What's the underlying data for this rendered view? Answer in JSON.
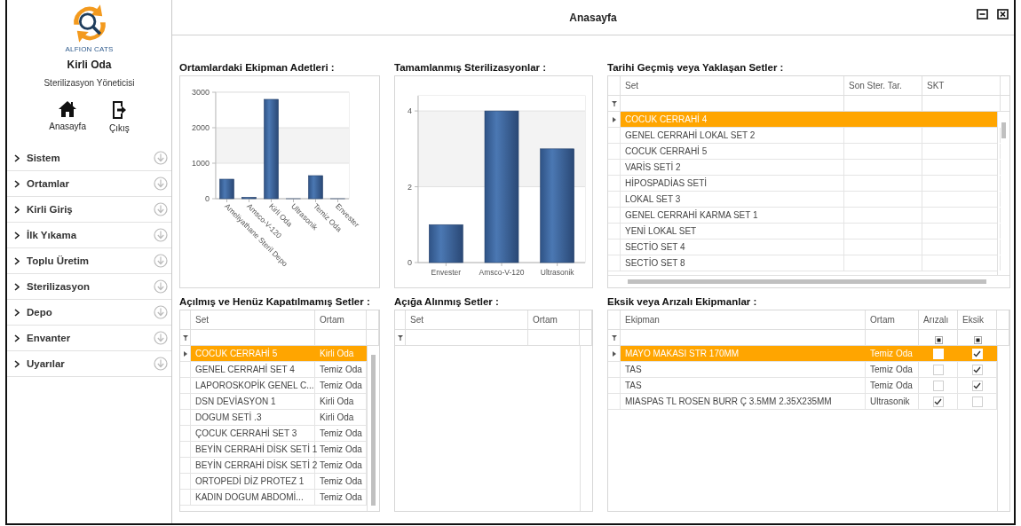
{
  "window": {
    "title": "Anasayfa"
  },
  "sidebar": {
    "brand": "ALFION CATS",
    "location": "Kirli Oda",
    "role": "Sterilizasyon Yöneticisi",
    "shortcuts": [
      {
        "kind": "home",
        "label": "Anasayfa"
      },
      {
        "kind": "exit",
        "label": "Çıkış"
      }
    ],
    "items": [
      {
        "label": "Sistem"
      },
      {
        "label": "Ortamlar"
      },
      {
        "label": "Kirli Giriş"
      },
      {
        "label": "İlk Yıkama"
      },
      {
        "label": "Toplu Üretim"
      },
      {
        "label": "Sterilizasyon"
      },
      {
        "label": "Depo"
      },
      {
        "label": "Envanter"
      },
      {
        "label": "Uyarılar"
      }
    ]
  },
  "equipment_chart": {
    "title": "Ortamlardaki Ekipman Adetleri :",
    "chart_data": {
      "type": "bar",
      "categories": [
        "Ameliyathane Steril Depo",
        "Amsco-V-120",
        "Kirli Oda",
        "Ultrasonik",
        "Temiz Oda",
        "Envester"
      ],
      "values": [
        550,
        40,
        2800,
        0,
        650,
        0
      ],
      "ylim": [
        0,
        3000
      ],
      "yticks": [
        0,
        1000,
        2000,
        3000
      ]
    }
  },
  "sterilization_chart": {
    "title": "Tamamlanmış Sterilizasyonlar :",
    "chart_data": {
      "type": "bar",
      "categories": [
        "Envester",
        "Amsco-V-120",
        "Ultrasonik"
      ],
      "values": [
        1,
        4,
        3
      ],
      "ylim": [
        0,
        4.4
      ],
      "yticks": [
        0,
        2,
        4
      ]
    }
  },
  "tables": [
    {
      "title": "Tarihi Geçmiş veya Yaklaşan Setler :",
      "columns": [
        {
          "label": "Set",
          "kind": "text"
        },
        {
          "label": "Son Ster. Tar.",
          "kind": "text"
        },
        {
          "label": "SKT",
          "kind": "text"
        }
      ],
      "rows": [
        {
          "cells": [
            "COCUK CERRAHİ 4"
          ],
          "selected": true
        },
        {
          "cells": [
            "GENEL CERRAHİ LOKAL SET 2"
          ],
          "selected": false
        },
        {
          "cells": [
            "COCUK CERRAHİ 5"
          ],
          "selected": false
        },
        {
          "cells": [
            "VARİS SETİ 2"
          ],
          "selected": false
        },
        {
          "cells": [
            "HİPOSPADİAS SETİ"
          ],
          "selected": false
        },
        {
          "cells": [
            "LOKAL SET 3"
          ],
          "selected": false
        },
        {
          "cells": [
            "GENEL CERRAHİ KARMA SET 1"
          ],
          "selected": false
        },
        {
          "cells": [
            "YENİ LOKAL SET"
          ],
          "selected": false
        },
        {
          "cells": [
            "SECTİO SET 4"
          ],
          "selected": false
        },
        {
          "cells": [
            "SECTİO SET 8"
          ],
          "selected": false
        }
      ]
    },
    {
      "title": "Açılmış ve Henüz Kapatılmamış Setler :",
      "columns": [
        {
          "label": "Set",
          "kind": "text"
        },
        {
          "label": "Ortam",
          "kind": "text"
        }
      ],
      "rows": [
        {
          "cells": [
            "COCUK CERRAHİ 5",
            "Kirli Oda"
          ],
          "selected": true
        },
        {
          "cells": [
            "GENEL CERRAHİ SET 4",
            "Temiz Oda"
          ],
          "selected": false
        },
        {
          "cells": [
            "LAPOROSKOPİK GENEL C...",
            "Temiz Oda"
          ],
          "selected": false
        },
        {
          "cells": [
            "DSN  DEVİASYON 1",
            "Kirli Oda"
          ],
          "selected": false
        },
        {
          "cells": [
            "DOGUM SETİ  .3",
            "Kirli Oda"
          ],
          "selected": false
        },
        {
          "cells": [
            "ÇOCUK CERRAHİ SET 3",
            "Temiz Oda"
          ],
          "selected": false
        },
        {
          "cells": [
            "BEYİN CERRAHİ DİSK SETİ 1",
            "Temiz Oda"
          ],
          "selected": false
        },
        {
          "cells": [
            "BEYİN CERRAHİ DİSK SETİ 2",
            "Temiz Oda"
          ],
          "selected": false
        },
        {
          "cells": [
            "ORTOPEDİ DİZ PROTEZ 1",
            "Temiz Oda"
          ],
          "selected": false
        },
        {
          "cells": [
            "KADIN DOGUM ABDOMİ...",
            "Temiz Oda"
          ],
          "selected": false
        }
      ]
    },
    {
      "title": "Açığa Alınmış Setler :",
      "columns": [
        {
          "label": "Set",
          "kind": "text"
        },
        {
          "label": "Ortam",
          "kind": "text"
        }
      ]
    },
    {
      "title": "Eksik veya Arızalı Ekipmanlar :",
      "columns": [
        {
          "label": "Ekipman",
          "kind": "text"
        },
        {
          "label": "Ortam",
          "kind": "text"
        },
        {
          "label": "Arızalı",
          "kind": "check"
        },
        {
          "label": "Eksik",
          "kind": "check"
        }
      ],
      "rows": [
        {
          "cells": [
            "MAYO MAKASI STR 170MM",
            "Temiz Oda"
          ],
          "checks": [
            false,
            true
          ],
          "selected": true
        },
        {
          "cells": [
            "TAS",
            "Temiz Oda"
          ],
          "checks": [
            false,
            true
          ],
          "selected": false
        },
        {
          "cells": [
            "TAS",
            "Temiz Oda"
          ],
          "checks": [
            false,
            true
          ],
          "selected": false
        },
        {
          "cells": [
            "MIASPAS TL ROSEN BURR Ç 3.5MM 2.35X235MM",
            "Ultrasonik"
          ],
          "checks": [
            true,
            false
          ],
          "selected": false
        }
      ]
    }
  ]
}
